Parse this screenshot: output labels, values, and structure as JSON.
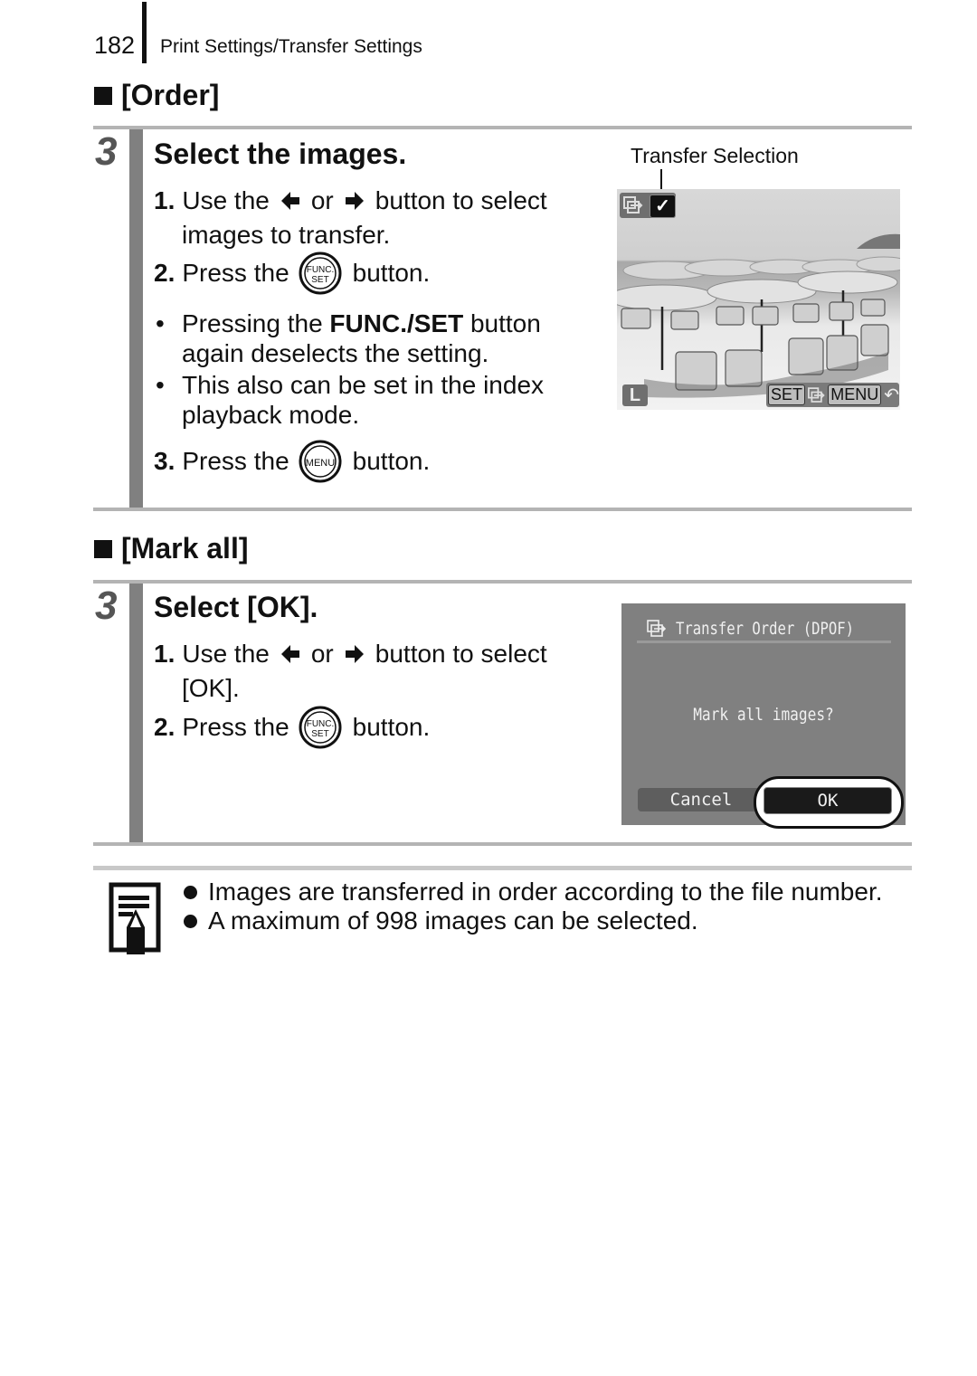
{
  "header": {
    "page_number": "182",
    "title": "Print Settings/Transfer Settings"
  },
  "order_section": {
    "title": "[Order]",
    "step_number": "3",
    "step_title": "Select the images.",
    "items": [
      {
        "num": "1.",
        "text_before": "Use the",
        "left_arrow": "left-arrow-button-icon",
        "or": "or",
        "right_arrow": "right-arrow-button-icon",
        "text_after": "button to select",
        "continuation": "images to transfer."
      },
      {
        "num": "2.",
        "text_before": "Press the",
        "button_icon": "func-set-button-icon",
        "text_after": "button."
      }
    ],
    "bullets": [
      {
        "prefix": "Pressing the ",
        "bold": "FUNC./SET",
        "suffix": " button",
        "continuation": "again deselects the setting."
      },
      {
        "text": "This also can be set in the index",
        "continuation": "playback mode."
      }
    ],
    "item3": {
      "num": "3.",
      "text_before": "Press the",
      "button_icon": "menu-button-icon",
      "text_after": "button."
    },
    "screen": {
      "caption": "Transfer Selection",
      "checkmark": "✓",
      "bottom_left": "L",
      "set_label": "SET",
      "menu_label": "MENU",
      "return_glyph": "↶"
    }
  },
  "mark_all_section": {
    "title": "[Mark all]",
    "step_number": "3",
    "step_title": "Select [OK].",
    "items": [
      {
        "num": "1.",
        "text_before": "Use the",
        "or": "or",
        "text_after": "button to select",
        "continuation": "[OK]."
      },
      {
        "num": "2.",
        "text_before": "Press the",
        "button_icon": "func-set-button-icon",
        "text_after": "button."
      }
    ],
    "screen": {
      "title": "Transfer Order (DPOF)",
      "message": "Mark all images?",
      "cancel_label": "Cancel",
      "ok_label": "OK",
      "selected": "OK"
    }
  },
  "notes": [
    "Images are transferred in order according to the file number.",
    "A maximum of 998 images can be selected."
  ],
  "colors": {
    "step_bar": "#808080",
    "rule": "#b4b4b4",
    "dialog_bg": "#808080"
  }
}
